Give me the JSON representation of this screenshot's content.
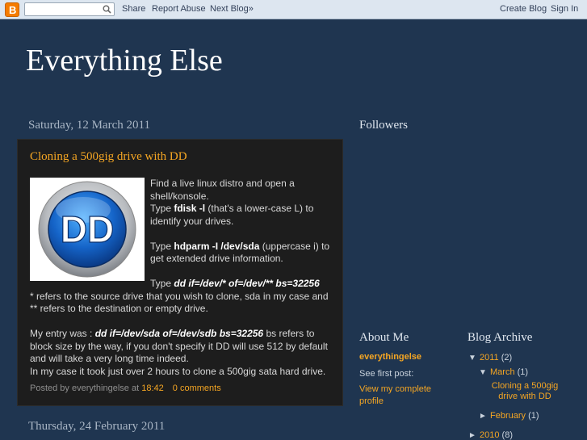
{
  "navbar": {
    "search_placeholder": "",
    "share": "Share",
    "report_abuse": "Report Abuse",
    "next_blog": "Next Blog»",
    "create_blog": "Create Blog",
    "sign_in": "Sign In"
  },
  "blog": {
    "title": "Everything Else"
  },
  "main": {
    "date1": "Saturday, 12 March 2011",
    "date2": "Thursday, 24 February 2011",
    "post": {
      "title": "Cloning a 500gig drive with DD",
      "image_text": "DD",
      "line1": "Find a live linux distro and open a shell/konsole.",
      "l2_pre": "Type ",
      "l2_bold": "fdisk -l",
      "l2_post": " (that's a lower-case L) to identify your drives.",
      "l3_pre": "Type ",
      "l3_bold": "hdparm -I /dev/sda",
      "l3_post": " (uppercase i) to get extended drive information.",
      "l4_pre": "Type ",
      "l4_bold": "dd if=/dev/* of=/dev/** bs=32256",
      "l5": "* refers to the source drive that you wish to clone, sda in my case and ** refers to the destination or empty drive.",
      "l6_pre": "My entry was : ",
      "l6_bold": "dd if=/dev/sda of=/dev/sdb bs=32256",
      "l6_post": " bs refers to block size by the way, if you don't specify it DD will use 512 by default and will take a very long time indeed.",
      "l7": "In my case it took just over 2 hours to clone a 500gig sata hard drive.",
      "footer_posted_by": "Posted by everythingelse at ",
      "footer_time": "18:42",
      "footer_comments": "0 comments"
    }
  },
  "sidebar": {
    "followers_heading": "Followers",
    "about_heading": "About Me",
    "profile_name": "everythingelse",
    "see_first_post": "See first post:",
    "view_profile": "View my complete profile",
    "archive_heading": "Blog Archive",
    "archive": {
      "y2011_toggle": "▼",
      "y2011": "2011",
      "y2011_count": "(2)",
      "march_toggle": "▼",
      "march": "March",
      "march_count": "(1)",
      "march_post": "Cloning a 500gig drive with DD",
      "feb_toggle": "►",
      "feb": "February",
      "feb_count": "(1)",
      "y2010_toggle": "►",
      "y2010": "2010",
      "y2010_count": "(8)"
    }
  },
  "colors": {
    "background": "#1f3550",
    "accent": "#f5a623",
    "post_bg": "#1d1d1d"
  }
}
